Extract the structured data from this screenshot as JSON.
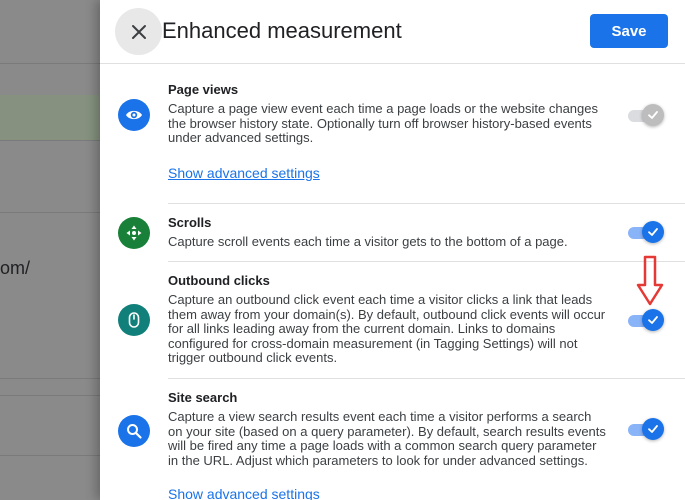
{
  "background": {
    "partial_text": "om/"
  },
  "header": {
    "title": "Enhanced measurement",
    "save_label": "Save",
    "close_icon": "close-icon"
  },
  "sections": [
    {
      "title": "Page views",
      "description": "Capture a page view event each time a page loads or the website changes the browser history state. Optionally turn off browser history-based events under advanced settings.",
      "link": "Show advanced settings",
      "icon": "eye-icon",
      "icon_color": "#1a73e8",
      "enabled": true,
      "disabled_state": true
    },
    {
      "title": "Scrolls",
      "description": "Capture scroll events each time a visitor gets to the bottom of a page.",
      "icon": "scroll-icon",
      "icon_color": "#188038",
      "enabled": true
    },
    {
      "title": "Outbound clicks",
      "description": "Capture an outbound click event each time a visitor clicks a link that leads them away from your domain(s). By default, outbound click events will occur for all links leading away from the current domain. Links to domains configured for cross-domain measurement (in Tagging Settings) will not trigger outbound click events.",
      "icon": "mouse-icon",
      "icon_color": "#12807a",
      "enabled": true
    },
    {
      "title": "Site search",
      "description": "Capture a view search results event each time a visitor performs a search on your site (based on a query parameter). By default, search results events will be fired any time a page loads with a common search query parameter in the URL. Adjust which parameters to look for under advanced settings.",
      "link": "Show advanced settings",
      "icon": "search-icon",
      "icon_color": "#1a73e8",
      "enabled": true
    }
  ],
  "colors": {
    "accent": "#1a73e8",
    "toggle_track_on": "#8ab4f8",
    "toggle_disabled_track": "#dadce0",
    "toggle_disabled_knob": "#bdbdbd",
    "annotation_arrow": "#e53935"
  }
}
